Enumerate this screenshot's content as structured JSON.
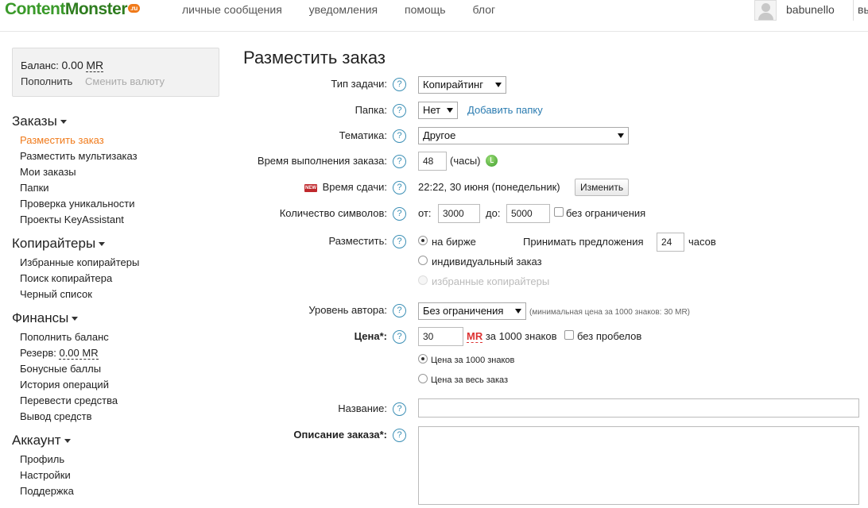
{
  "logo": {
    "part1": "Content",
    "part2": "Monster",
    "tld": ".ru"
  },
  "topnav": [
    "личные сообщения",
    "уведомления",
    "помощь",
    "блог"
  ],
  "user": {
    "name": "babunello",
    "exit": "вы"
  },
  "balance": {
    "label": "Баланс:",
    "amount": "0.00",
    "currency": "MR",
    "topup": "Пополнить",
    "change_currency": "Сменить валюту"
  },
  "sidebar": {
    "orders": {
      "title": "Заказы",
      "items": [
        "Разместить заказ",
        "Разместить мультизаказ",
        "Мои заказы",
        "Папки",
        "Проверка уникальности",
        "Проекты KeyAssistant"
      ]
    },
    "copywriters": {
      "title": "Копирайтеры",
      "items": [
        "Избранные копирайтеры",
        "Поиск копирайтера",
        "Черный список"
      ]
    },
    "finance": {
      "title": "Финансы",
      "topup": "Пополнить баланс",
      "reserve_label": "Резерв:",
      "reserve_amount": "0.00",
      "reserve_currency": "MR",
      "items": [
        "Бонусные баллы",
        "История операций",
        "Перевести средства",
        "Вывод средств"
      ]
    },
    "account": {
      "title": "Аккаунт",
      "items": [
        "Профиль",
        "Настройки",
        "Поддержка"
      ]
    }
  },
  "form": {
    "title": "Разместить заказ",
    "help": "?",
    "task_type": {
      "label": "Тип задачи:",
      "value": "Копирайтинг"
    },
    "folder": {
      "label": "Папка:",
      "value": "Нет",
      "add_link": "Добавить папку"
    },
    "topic": {
      "label": "Тематика:",
      "value": "Другое"
    },
    "exec_time": {
      "label": "Время выполнения заказа:",
      "value": "48",
      "unit": "(часы)"
    },
    "deadline": {
      "badge": "NEW",
      "label": "Время сдачи:",
      "value": "22:22, 30 июня (понедельник)",
      "change_button": "Изменить"
    },
    "chars": {
      "label": "Количество символов:",
      "from_label": "от:",
      "from_value": "3000",
      "to_label": "до:",
      "to_value": "5000",
      "no_limit": "без ограничения"
    },
    "place": {
      "label": "Разместить:",
      "options": [
        "на бирже",
        "индивидуальный заказ",
        "избранные копирайтеры"
      ],
      "accept_label": "Принимать предложения",
      "accept_value": "24",
      "accept_unit": "часов"
    },
    "author_level": {
      "label": "Уровень автора:",
      "value": "Без ограничения",
      "note": "(минимальная цена за 1000 знаков: 30 MR)"
    },
    "price": {
      "label": "Цена*:",
      "value": "30",
      "currency": "MR",
      "per": "за 1000 знаков",
      "no_spaces": "без пробелов",
      "options": [
        "Цена за 1000 знаков",
        "Цена за весь заказ"
      ]
    },
    "name": {
      "label": "Название:",
      "value": ""
    },
    "description": {
      "label": "Описание заказа*:",
      "value": ""
    }
  }
}
